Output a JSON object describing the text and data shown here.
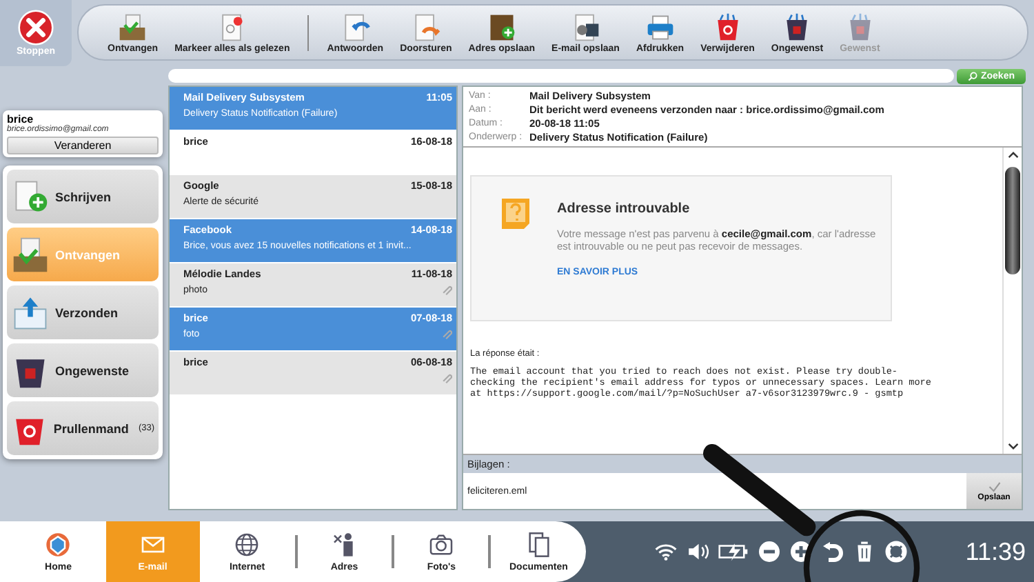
{
  "toolbar": {
    "close_label": "Stoppen",
    "buttons": [
      {
        "label": "Ontvangen",
        "disabled": false
      },
      {
        "label": "Markeer alles als gelezen",
        "disabled": false
      },
      {
        "label": "Antwoorden",
        "disabled": false
      },
      {
        "label": "Doorsturen",
        "disabled": false
      },
      {
        "label": "Adres opslaan",
        "disabled": false
      },
      {
        "label": "E-mail opslaan",
        "disabled": false
      },
      {
        "label": "Afdrukken",
        "disabled": false
      },
      {
        "label": "Verwijderen",
        "disabled": false
      },
      {
        "label": "Ongewenst",
        "disabled": false
      },
      {
        "label": "Gewenst",
        "disabled": true
      }
    ]
  },
  "search": {
    "button": "Zoeken"
  },
  "account": {
    "name": "brice",
    "email": "brice.ordissimo@gmail.com",
    "button": "Veranderen"
  },
  "folders": [
    {
      "label": "Schrijven",
      "selected": false
    },
    {
      "label": "Ontvangen",
      "selected": true
    },
    {
      "label": "Verzonden",
      "selected": false
    },
    {
      "label": "Ongewenste",
      "selected": false
    },
    {
      "label": "Prullenmand",
      "count": "(33)",
      "selected": false
    }
  ],
  "messages": [
    {
      "sender": "Mail Delivery Subsystem",
      "date": "11:05",
      "preview": "Delivery Status Notification (Failure)",
      "selected": true,
      "unread": false,
      "attachment": false
    },
    {
      "sender": "brice",
      "date": "16-08-18",
      "selected": false,
      "unread": true,
      "attachment": false
    },
    {
      "sender": "Google",
      "date": "15-08-18",
      "preview": "Alerte de sécurité",
      "selected": false,
      "unread": false,
      "attachment": false
    },
    {
      "sender": "Facebook",
      "date": "14-08-18",
      "preview": "Brice, vous avez 15 nouvelles notifications et 1 invit...",
      "selected": true,
      "unread": false,
      "attachment": false
    },
    {
      "sender": "Mélodie Landes",
      "date": "11-08-18",
      "preview": "photo",
      "selected": false,
      "unread": false,
      "attachment": true
    },
    {
      "sender": "brice",
      "date": "07-08-18",
      "preview": "foto",
      "selected": true,
      "unread": false,
      "attachment": true
    },
    {
      "sender": "brice",
      "date": "06-08-18",
      "selected": false,
      "unread": false,
      "attachment": true
    }
  ],
  "reader": {
    "fields": [
      {
        "label": "Van :",
        "value": "Mail Delivery Subsystem"
      },
      {
        "label": "Aan :",
        "value": "Dit bericht werd eveneens verzonden naar : brice.ordissimo@gmail.com"
      },
      {
        "label": "Datum :",
        "value": "20-08-18 11:05"
      },
      {
        "label": "Onderwerp :",
        "value": "Delivery Status Notification (Failure)"
      }
    ],
    "card": {
      "title": "Adresse introuvable",
      "text": "Votre message n'est pas parvenu à **cecile@gmail.com**, car l'adresse est introuvable ou ne peut pas recevoir de messages.",
      "link": "EN SAVOIR PLUS"
    },
    "response_label": "La réponse était :",
    "response_lines": [
      "The email account that you tried to reach does not exist. Please try double-",
      "checking the recipient's email address for typos or unnecessary spaces. Learn more",
      "at https://support.google.com/mail/?p=NoSuchUser a7-v6sor3123979wrc.9 - gsmtp"
    ],
    "attachments_label": "Bijlagen :",
    "attachment": "feliciteren.eml",
    "save_button": "Opslaan"
  },
  "taskbar": {
    "apps": [
      {
        "label": "Home",
        "selected": false
      },
      {
        "label": "E-mail",
        "selected": true
      },
      {
        "label": "Internet",
        "selected": false
      },
      {
        "label": "Adres",
        "selected": false
      },
      {
        "label": "Foto's",
        "selected": false
      },
      {
        "label": "Documenten",
        "selected": false
      }
    ],
    "clock": "11:39"
  }
}
